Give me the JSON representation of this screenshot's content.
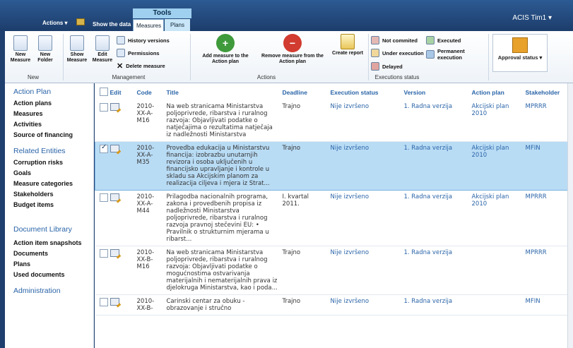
{
  "topbar": {
    "tools_label": "Tools",
    "actions_menu": "Actions ▾",
    "show_data": "Show the data",
    "tabs": [
      "Measures",
      "Plans"
    ],
    "user": "ACIS Tim1 ▾"
  },
  "ribbon": {
    "new_group": {
      "label": "New",
      "new_measure": "New Measure",
      "new_folder": "New Folder"
    },
    "management": {
      "label": "Management",
      "show_measure": "Show Measure",
      "edit_measure": "Edit Measure",
      "history": "History versions",
      "permissions": "Permissions",
      "delete": "Delete measure"
    },
    "actions": {
      "label": "Actions",
      "add": "Add measure to the Action plan",
      "remove": "Remove measure from the Action plan",
      "report": "Create report"
    },
    "execution": {
      "label": "Executions status",
      "not_committed": "Not commited",
      "under_execution": "Under execution",
      "delayed": "Delayed",
      "executed": "Executed",
      "permanent": "Permanent execution"
    },
    "approval": {
      "label": "Approval status ▾"
    }
  },
  "sidebar": {
    "sections": [
      {
        "head": "Action Plan",
        "items": [
          "Action plans",
          "Measures",
          "Activities",
          "Source of financing"
        ]
      },
      {
        "head": "Related Entities",
        "items": [
          "Corruption risks",
          "Goals",
          "Measure categories",
          "Stakeholders",
          "Budget items"
        ]
      },
      {
        "head": "Document Library",
        "items": [
          "Action item snapshots",
          "Documents",
          "Plans",
          "Used documents"
        ]
      },
      {
        "head": "Administration",
        "items": []
      }
    ]
  },
  "table": {
    "headers": [
      "Edit",
      "Code",
      "Title",
      "Deadline",
      "Execution status",
      "Version",
      "Action plan",
      "Stakeholder"
    ],
    "rows": [
      {
        "code": "2010-XX-A-M16",
        "title": "Na web stranicama Ministarstva poljoprivrede, ribarstva i ruralnog razvoja: Objavljivati podatke o natječajima o rezultatima natječaja iz nadležnosti Ministarstva",
        "deadline": "Trajno",
        "status": "Nije izvršeno",
        "version": "1. Radna verzija",
        "plan": "Akcijski plan 2010",
        "stakeholder": "MPRRR",
        "selected": false
      },
      {
        "code": "2010-XX-A-M35",
        "title": "Provedba edukacija u Ministarstvu financija: izobrazbu unutarnjih revizora i osoba uključenih u financijsko upravljanje i kontrole u skladu sa Akcijskim planom za realizacija ciljeva i mjera iz Strat...",
        "deadline": "Trajno",
        "status": "Nije izvršeno",
        "version": "1. Radna verzija",
        "plan": "Akcijski plan 2010",
        "stakeholder": "MFIN",
        "selected": true
      },
      {
        "code": "2010-XX-A-M44",
        "title": "Prilagodba nacionalnih programa, zakona i provedbenih propisa iz nadležnosti Ministarstva poljoprivrede, ribarstva i ruralnog razvoja pravnoj stečevini EU: • Pravilnik o strukturnim mjerama u ribarst...",
        "deadline": "I. kvartal 2011.",
        "status": "Nije izvršeno",
        "version": "1. Radna verzija",
        "plan": "Akcijski plan 2010",
        "stakeholder": "MPRRR",
        "selected": false
      },
      {
        "code": "2010-XX-B-M16",
        "title": "Na web stranicama Ministarstva poljoprivrede, ribarstva i ruralnog razvoja: Objavljivati podatke o mogućnostima ostvarivanja materijalnih i nematerijalnih prava iz djelokruga Ministarstva, kao i poda...",
        "deadline": "Trajno",
        "status": "Nije izvršeno",
        "version": "1. Radna verzija",
        "plan": "",
        "stakeholder": "MPRRR",
        "selected": false
      },
      {
        "code": "2010-XX-B-",
        "title": "Carinski centar za obuku - obrazovanje i stručno",
        "deadline": "Trajno",
        "status": "Nije izvršeno",
        "version": "1. Radna verzija",
        "plan": "",
        "stakeholder": "MFIN",
        "selected": false
      }
    ]
  }
}
